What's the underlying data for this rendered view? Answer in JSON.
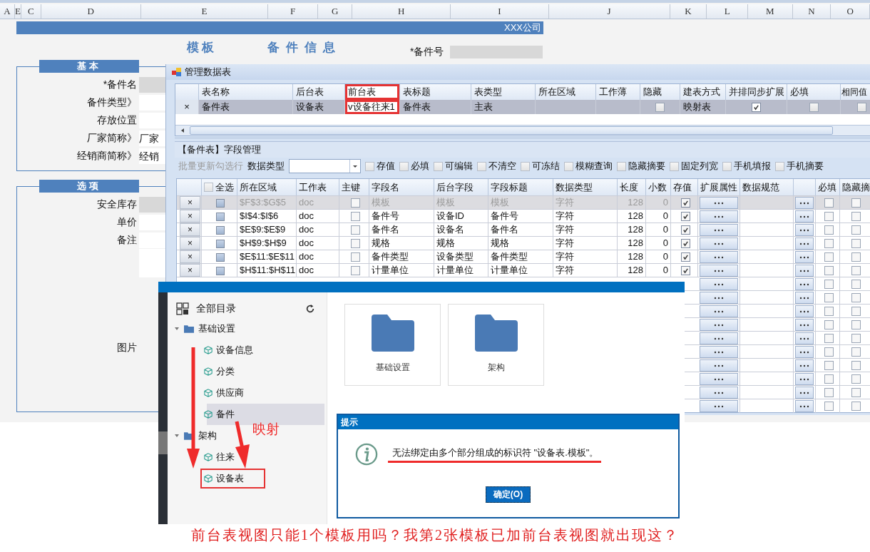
{
  "sheet": {
    "columns": [
      "A",
      "E",
      "C",
      "D",
      "E",
      "F",
      "G",
      "H",
      "I",
      "J",
      "K",
      "L",
      "M",
      "N",
      "O"
    ],
    "company": "XXX公司",
    "title_left": "模板",
    "title_right": "备件信息",
    "top_field": {
      "label": "*备件号",
      "kind": "locked"
    },
    "sections": [
      {
        "title": "基本",
        "fields": [
          {
            "label": "*备件名",
            "kind": "locked"
          },
          {
            "label": "备件类型》",
            "kind": "input"
          },
          {
            "label": "存放位置",
            "kind": "input"
          },
          {
            "label": "厂家简称》",
            "kind": "input",
            "value": "厂家"
          },
          {
            "label": "经销商简称》",
            "kind": "input",
            "value": "经销"
          }
        ]
      },
      {
        "title": "选项",
        "fields": [
          {
            "label": "安全库存",
            "kind": "locked"
          },
          {
            "label": "单价",
            "kind": "input"
          },
          {
            "label": "备注",
            "kind": "input"
          },
          {
            "label": "图片",
            "kind": "image"
          }
        ]
      }
    ]
  },
  "dialog": {
    "title": "管理数据表",
    "table": {
      "columns": [
        {
          "label": "表名称",
          "highlighted": false
        },
        {
          "label": "后台表",
          "highlighted": false
        },
        {
          "label": "前台表",
          "highlighted": true
        },
        {
          "label": "表标题",
          "highlighted": false
        },
        {
          "label": "表类型",
          "highlighted": false
        },
        {
          "label": "所在区域",
          "highlighted": false
        },
        {
          "label": "工作薄",
          "highlighted": false
        },
        {
          "label": "隐藏",
          "highlighted": false
        },
        {
          "label": "建表方式",
          "highlighted": false
        },
        {
          "label": "并排同步扩展",
          "highlighted": false
        },
        {
          "label": "必填",
          "highlighted": false
        },
        {
          "label": "相同值",
          "highlighted": false
        }
      ],
      "rows": [
        {
          "marker": "×",
          "name": "备件表",
          "backend": "设备表",
          "frontend": "v设备往来1",
          "caption": "备件表",
          "type": "主表",
          "hidden": false,
          "build_mode": "映射表",
          "sync_expand": true,
          "required": false,
          "same_value": false
        }
      ]
    },
    "fields": {
      "title": "【备件表】字段管理",
      "batch_label": "批量更新勾选行",
      "type_label": "数据类型",
      "options": [
        {
          "label": "存值",
          "checked": false
        },
        {
          "label": "必填",
          "checked": false
        },
        {
          "label": "可编辑",
          "checked": false
        },
        {
          "label": "不清空",
          "checked": false
        },
        {
          "label": "可冻结",
          "checked": false
        },
        {
          "label": "模糊查询",
          "checked": false
        },
        {
          "label": "隐藏摘要",
          "checked": false
        },
        {
          "label": "固定列宽",
          "checked": false
        },
        {
          "label": "手机填报",
          "checked": false
        },
        {
          "label": "手机摘要",
          "checked": false
        }
      ],
      "select_all": {
        "label": "全选",
        "checked": false
      },
      "columns": [
        "所在区域",
        "工作表",
        "主键",
        "字段名",
        "后台字段",
        "字段标题",
        "数据类型",
        "长度",
        "小数",
        "存值",
        "扩展属性",
        "数据规范",
        "必填",
        "隐藏摘"
      ],
      "rows": [
        {
          "marker": "×",
          "area": "$F$3:$G$5",
          "sheet": "doc",
          "key": false,
          "name": "模板",
          "backend": "模板",
          "caption": "模板",
          "dtype": "字符",
          "length": "128",
          "decimals": "0",
          "store": true,
          "required": false,
          "hide_summary": false,
          "disabled": true
        },
        {
          "marker": "×",
          "area": "$I$4:$I$6",
          "sheet": "doc",
          "key": false,
          "name": "备件号",
          "backend": "设备ID",
          "caption": "备件号",
          "dtype": "字符",
          "length": "128",
          "decimals": "0",
          "store": true,
          "required": false,
          "hide_summary": false,
          "disabled": false
        },
        {
          "marker": "×",
          "area": "$E$9:$E$9",
          "sheet": "doc",
          "key": false,
          "name": "备件名",
          "backend": "设备名",
          "caption": "备件名",
          "dtype": "字符",
          "length": "128",
          "decimals": "0",
          "store": true,
          "required": false,
          "hide_summary": false,
          "disabled": false
        },
        {
          "marker": "×",
          "area": "$H$9:$H$9",
          "sheet": "doc",
          "key": false,
          "name": "规格",
          "backend": "规格",
          "caption": "规格",
          "dtype": "字符",
          "length": "128",
          "decimals": "0",
          "store": true,
          "required": false,
          "hide_summary": false,
          "disabled": false
        },
        {
          "marker": "×",
          "area": "$E$11:$E$11",
          "sheet": "doc",
          "key": false,
          "name": "备件类型",
          "backend": "设备类型",
          "caption": "备件类型",
          "dtype": "字符",
          "length": "128",
          "decimals": "0",
          "store": true,
          "required": false,
          "hide_summary": false,
          "disabled": false
        },
        {
          "marker": "×",
          "area": "$H$11:$H$11",
          "sheet": "doc",
          "key": false,
          "name": "计量单位",
          "backend": "计量单位",
          "caption": "计量单位",
          "dtype": "字符",
          "length": "128",
          "decimals": "0",
          "store": true,
          "required": false,
          "hide_summary": false,
          "disabled": false
        }
      ],
      "more_rows": [
        {
          "required": false,
          "hide_summary": false
        },
        {
          "required": false,
          "hide_summary": false
        },
        {
          "required": false,
          "hide_summary": false
        },
        {
          "required": false,
          "hide_summary": false
        },
        {
          "required": false,
          "hide_summary": false
        },
        {
          "required": false,
          "hide_summary": false
        },
        {
          "required": false,
          "hide_summary": false
        },
        {
          "required": false,
          "hide_summary": false
        },
        {
          "required": false,
          "hide_summary": false
        },
        {
          "required": false,
          "hide_summary": false
        }
      ]
    }
  },
  "app": {
    "tree_title": "全部目录",
    "tree": [
      {
        "label": "基础设置",
        "expanded": true,
        "children": [
          {
            "label": "设备信息",
            "selected": false,
            "highlighted": false
          },
          {
            "label": "分类",
            "selected": false,
            "highlighted": false
          },
          {
            "label": "供应商",
            "selected": false,
            "highlighted": false
          },
          {
            "label": "备件",
            "selected": true,
            "highlighted": false
          }
        ]
      },
      {
        "label": "架构",
        "expanded": true,
        "children": [
          {
            "label": "往来",
            "selected": false,
            "highlighted": false
          },
          {
            "label": "设备表",
            "selected": false,
            "highlighted": true
          }
        ]
      }
    ],
    "cards": [
      {
        "label": "基础设置"
      },
      {
        "label": "架构"
      }
    ],
    "annotation": "映射",
    "alert": {
      "title": "提示",
      "message": "无法绑定由多个部分组成的标识符 \"设备表.模板\"。",
      "button": "确定(O)"
    }
  },
  "caption": "前台表视图只能1个模板用吗？我第2张模板已加前台表视图就出现这？"
}
